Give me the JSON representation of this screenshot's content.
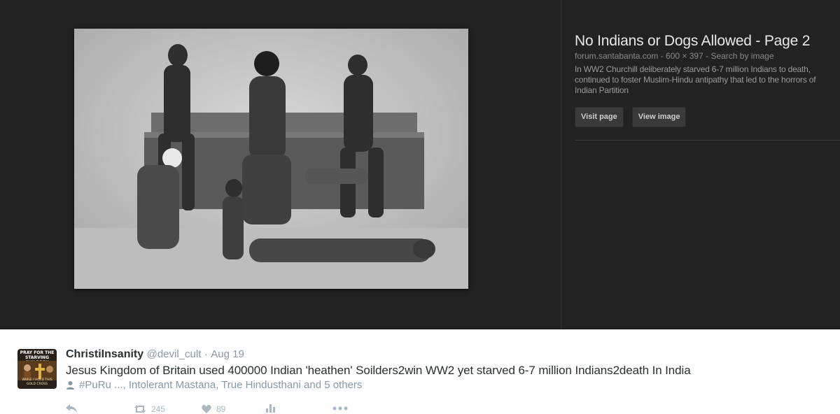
{
  "result": {
    "title": "No Indians or Dogs Allowed - Page 2",
    "meta": "forum.santabanta.com - 600 × 397 - Search by image",
    "description": "In WW2 Churchill deliberately starved 6-7 million Indians to death, continued to foster Muslim-Hindu antipathy that led to the horrors of Indian Partition",
    "visit_label": "Visit page",
    "view_label": "View image"
  },
  "tweet": {
    "name": "ChristiInsanity",
    "handle": "@devil_cult",
    "separator": "·",
    "date": "Aug 19",
    "text": "Jesus Kingdom of Britain used 400000 Indian 'heathen' Soilders2win WW2 yet starved 6-7 million Indians2death In India",
    "context": "#PuRu ..., Intolerant Mastana, True Hindusthani and 5 others",
    "avatar_top": "PRAY FOR THE STARVING CHILDREN",
    "avatar_bottom": "WHILE I HOLD THIS GOLD CROSS",
    "retweet_count": "245",
    "like_count": "89"
  },
  "icons": {
    "reply": "reply-icon",
    "retweet": "retweet-icon",
    "like": "heart-icon",
    "analytics": "analytics-icon",
    "more": "more-icon",
    "context": "person-icon"
  }
}
